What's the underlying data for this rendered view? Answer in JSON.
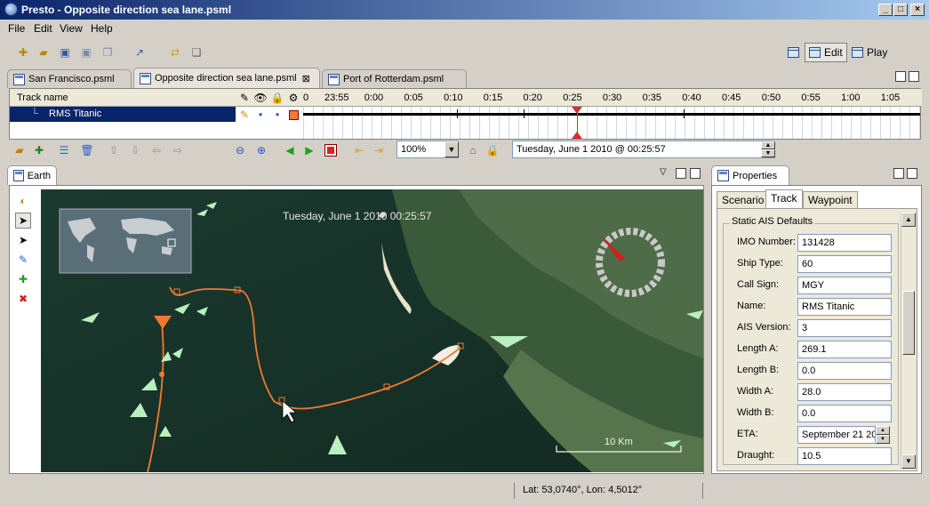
{
  "window": {
    "title": "Presto - Opposite direction sea lane.psml",
    "min_label": "_",
    "max_label": "□",
    "close_label": "×"
  },
  "menu": [
    "File",
    "Edit",
    "View",
    "Help"
  ],
  "perspectives": {
    "edit_label": "Edit",
    "play_label": "Play"
  },
  "editor_tabs": [
    {
      "label": "San Francisco.psml"
    },
    {
      "label": "Opposite direction sea lane.psml"
    },
    {
      "label": "Port of Rotterdam.psml"
    }
  ],
  "track_table": {
    "header": "Track name",
    "time_ticks": [
      "23:55",
      "0:00",
      "0:05",
      "0:10",
      "0:15",
      "0:20",
      "0:25",
      "0:30",
      "0:35",
      "0:40",
      "0:45",
      "0:50",
      "0:55",
      "1:00",
      "1:05"
    ],
    "tracks": [
      {
        "name": "RMS Titanic"
      }
    ]
  },
  "track_toolbar": {
    "zoom_value": "100%",
    "datetime_value": "Tuesday, June 1 2010 @ 00:25:57"
  },
  "earth": {
    "tab_label": "Earth",
    "overlay_time": "Tuesday, June 1 2010  00:25:57",
    "scale_label": "10 Km"
  },
  "properties": {
    "tab_label": "Properties",
    "tabs": [
      "Scenario",
      "Track",
      "Waypoint"
    ],
    "group_label": "Static AIS Defaults",
    "fields": [
      {
        "label": "IMO Number:",
        "value": "131428"
      },
      {
        "label": "Ship Type:",
        "value": "60"
      },
      {
        "label": "Call Sign:",
        "value": "MGY"
      },
      {
        "label": "Name:",
        "value": "RMS Titanic"
      },
      {
        "label": "AIS Version:",
        "value": "3"
      },
      {
        "label": "Length A:",
        "value": "269.1"
      },
      {
        "label": "Length B:",
        "value": "0.0"
      },
      {
        "label": "Width A:",
        "value": "28.0"
      },
      {
        "label": "Width B:",
        "value": "0.0"
      },
      {
        "label": "ETA:",
        "value": "September 21 20"
      },
      {
        "label": "Draught:",
        "value": "10.5"
      }
    ]
  },
  "status": {
    "coords": "Lat: 53,0740°, Lon: 4,5012°"
  },
  "colors": {
    "title_bar": "#0a246a",
    "track_line": "#f07a30",
    "selection": "#0a246a"
  }
}
